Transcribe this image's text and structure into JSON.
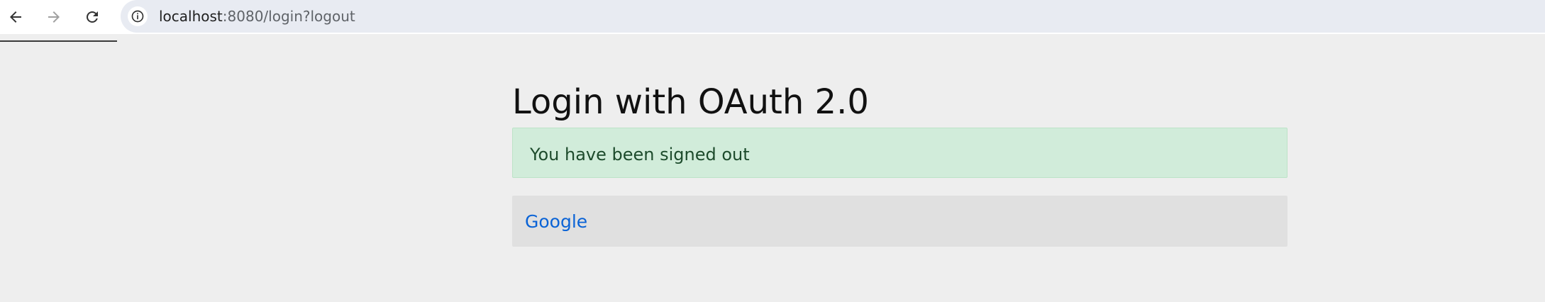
{
  "browser": {
    "url_host": "localhost",
    "url_rest": ":8080/login?logout",
    "icons": {
      "back": "arrow-left-icon",
      "forward": "arrow-right-icon",
      "reload": "reload-icon",
      "site_info": "info-icon"
    }
  },
  "page": {
    "heading": "Login with OAuth 2.0",
    "alert_message": "You have been signed out",
    "providers": [
      {
        "label": "Google"
      }
    ]
  },
  "colors": {
    "page_background": "#eeeeee",
    "alert_background": "#d1ecda",
    "alert_text": "#1d4b2c",
    "link": "#0a63d6",
    "provider_background": "#e0e0e0"
  }
}
